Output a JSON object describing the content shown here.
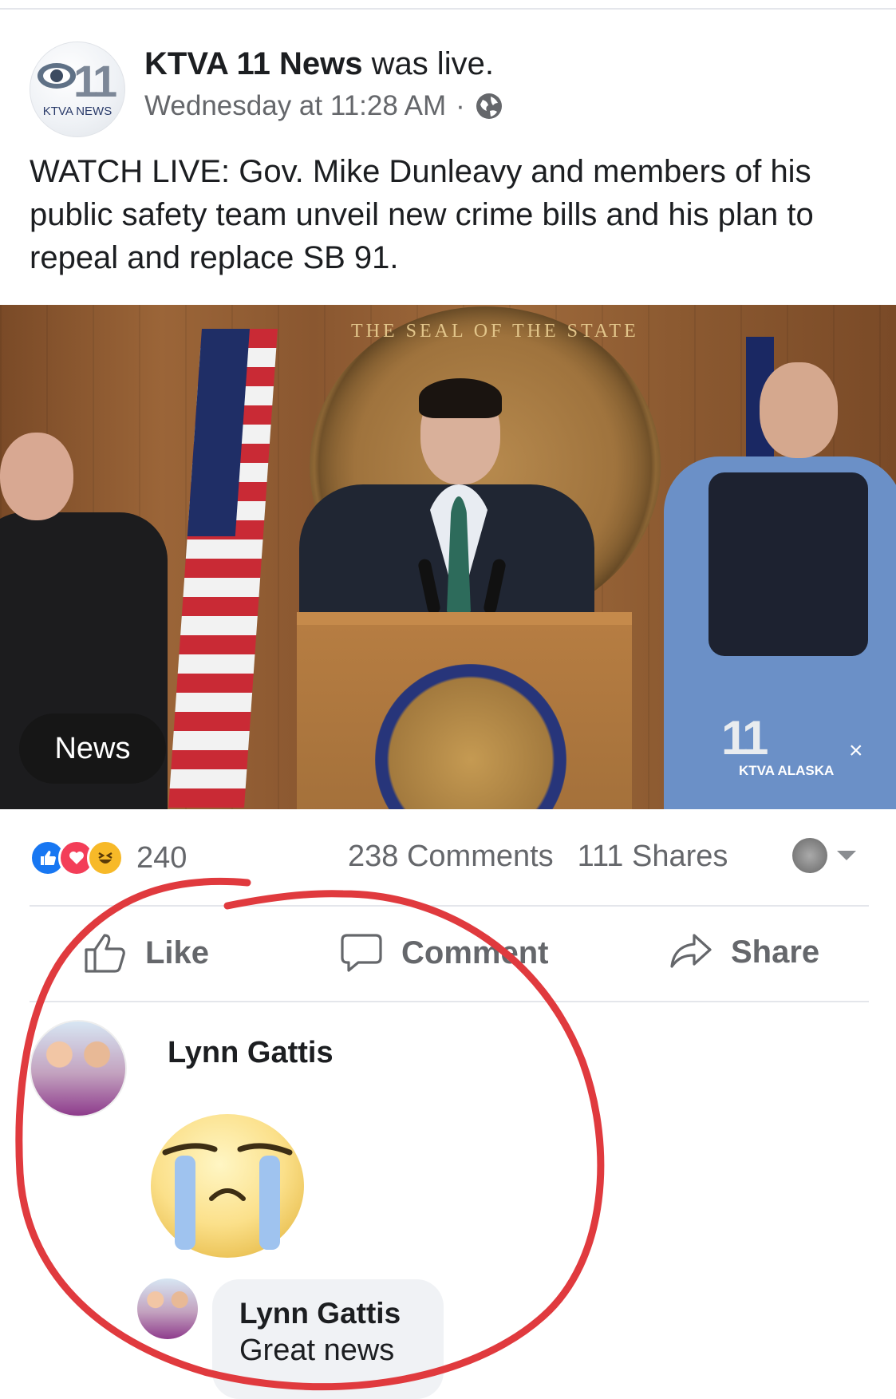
{
  "post": {
    "page_name": "KTVA 11 News",
    "action": "was live.",
    "time": "Wednesday at 11:28 AM",
    "separator": "·",
    "privacy_icon": "globe-icon",
    "caption": "WATCH LIVE: Gov. Mike Dunleavy and members of his public safety team unveil new crime bills and his plan to repeal and replace SB 91.",
    "avatar_number": "11",
    "avatar_brand": "KTVA NEWS"
  },
  "video": {
    "overlay_label": "News",
    "bug_number": "11",
    "bug_text": "KTVA ALASKA",
    "bug_close": "×",
    "seal_text": "THE SEAL OF THE STATE"
  },
  "engagement": {
    "reaction_icons": [
      "like-reaction-icon",
      "love-reaction-icon",
      "haha-reaction-icon"
    ],
    "reaction_count": "240",
    "comments": "238 Comments",
    "shares": "111 Shares"
  },
  "actions": {
    "like": "Like",
    "comment": "Comment",
    "share": "Share"
  },
  "comments": [
    {
      "author": "Lynn Gattis",
      "sticker": "crying-face-sticker"
    },
    {
      "author": "Lynn Gattis",
      "text": "Great news"
    }
  ],
  "colors": {
    "facebook_blue": "#1877f2",
    "love_red": "#f33e58",
    "haha_yellow": "#f7b928",
    "annotation_circle": "#e03a3e",
    "secondary_text": "#65676b"
  }
}
